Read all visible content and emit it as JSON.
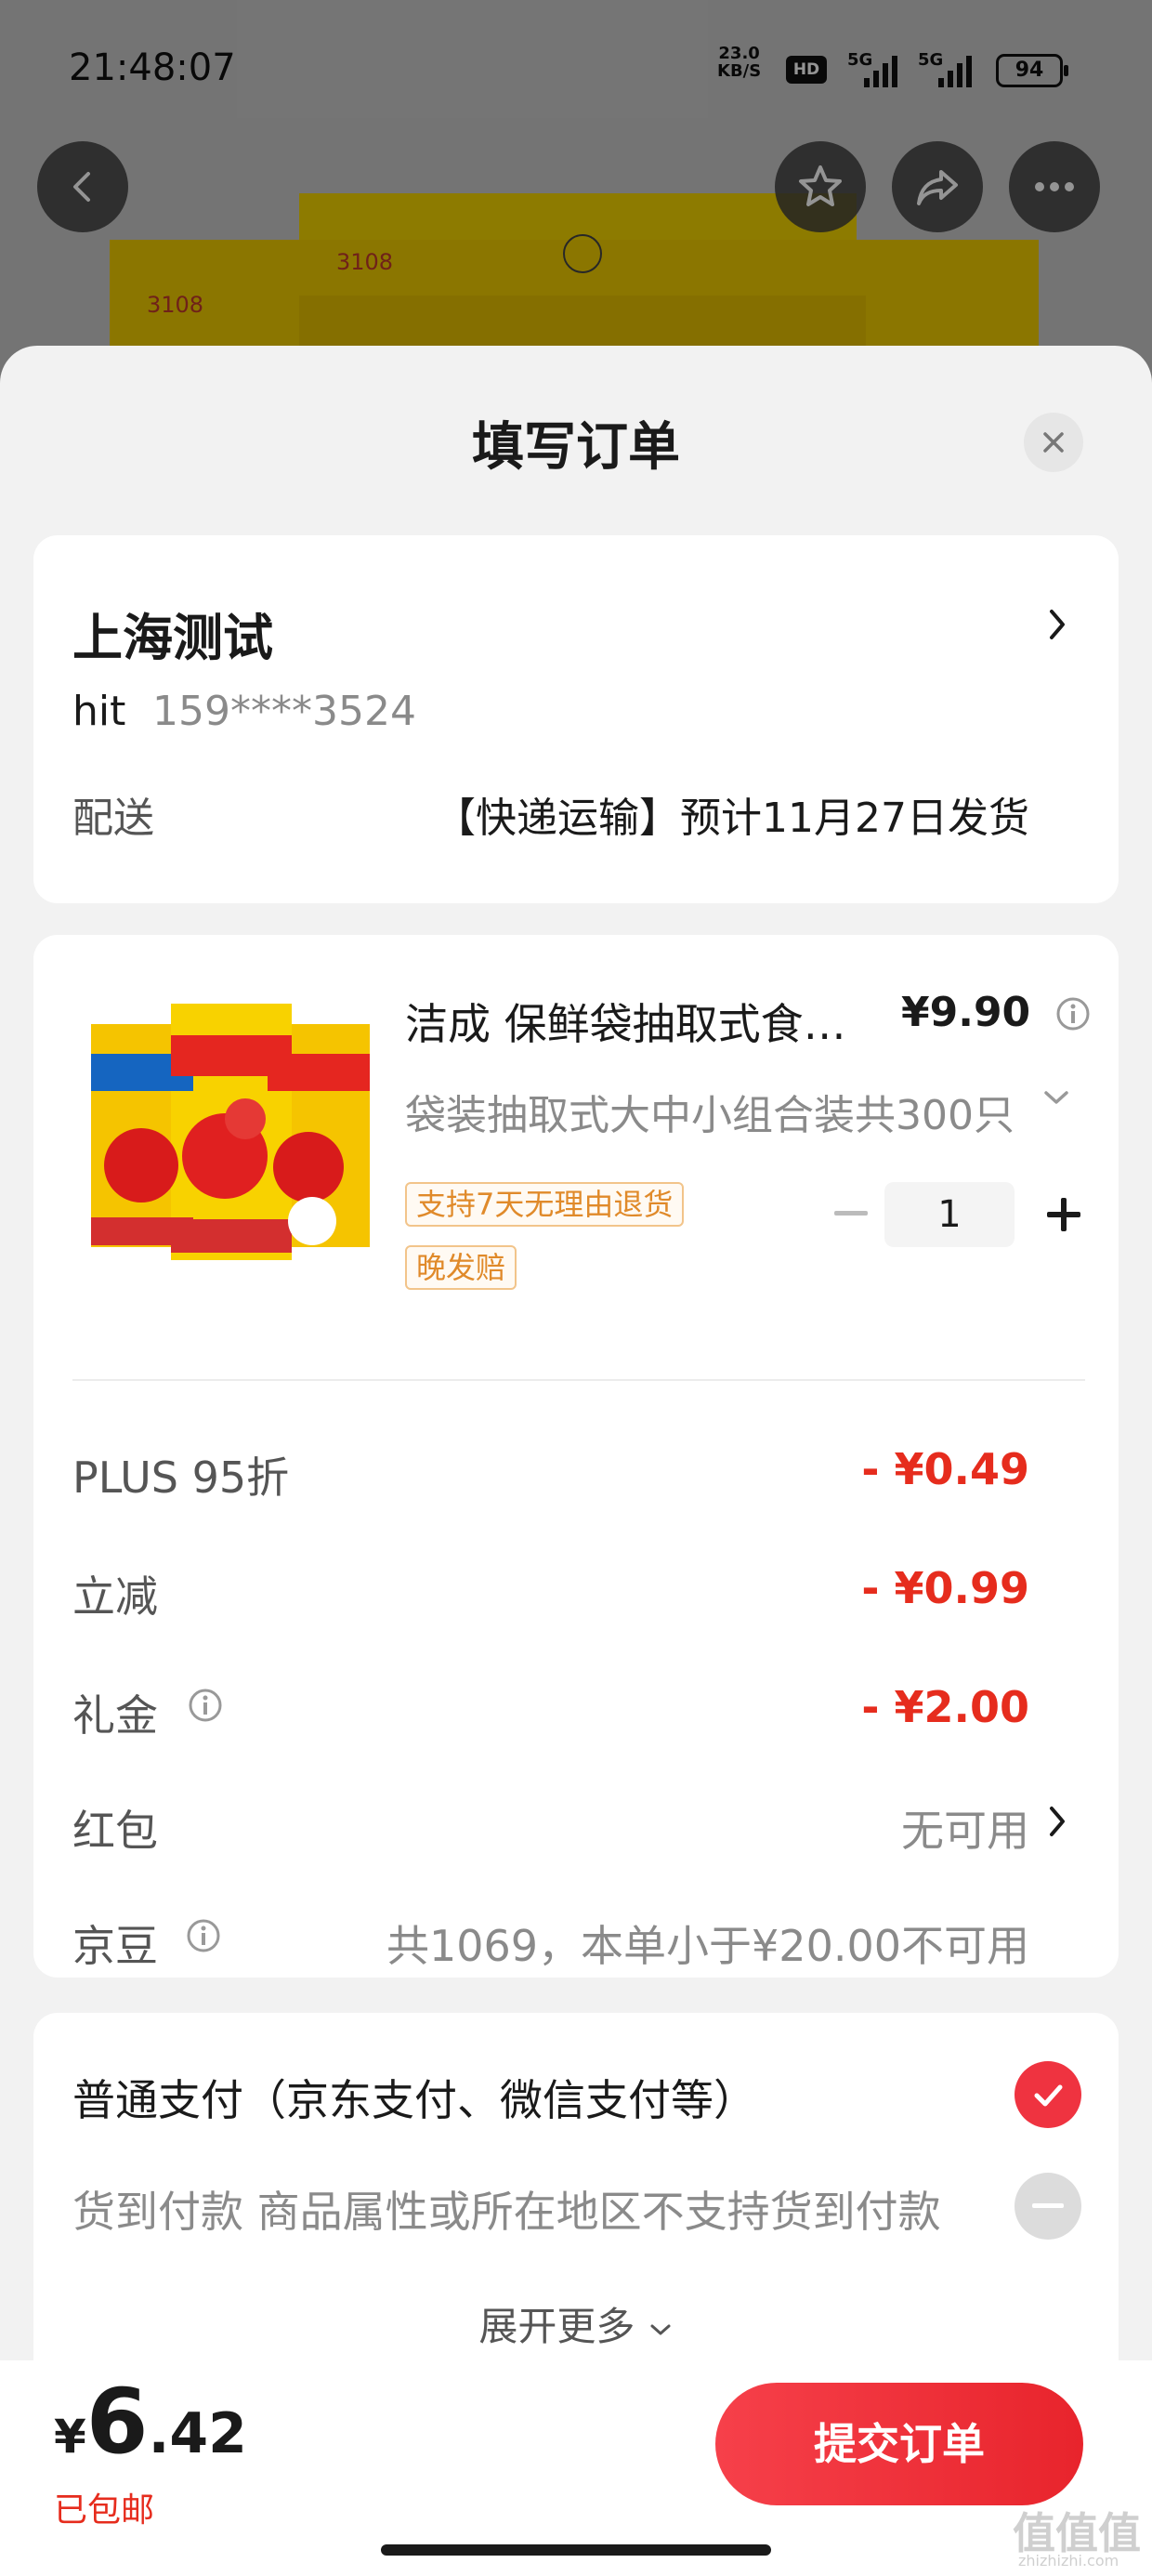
{
  "status_bar": {
    "time": "21:48:07",
    "speed_value": "23.0",
    "speed_unit": "KB/S",
    "hd": "HD",
    "sig1": "5G",
    "sig2": "5G",
    "battery": "94"
  },
  "background": {
    "code1": "3108",
    "code2": "3108"
  },
  "sheet": {
    "title": "填写订单"
  },
  "address": {
    "name": "上海测试",
    "person": "hit",
    "phone": "159****3524",
    "delivery_label": "配送",
    "delivery_value": "【快递运输】预计11月27日发货"
  },
  "product": {
    "name": "洁成 保鲜袋抽取式食品级家用一次性",
    "price": "¥9.90",
    "spec": "袋装抽取式大中小组合装共300只",
    "tags": [
      "支持7天无理由退货",
      "晚发赔"
    ],
    "quantity": "1"
  },
  "discounts": [
    {
      "label": "PLUS 95折",
      "value": "- ¥0.49"
    },
    {
      "label": "立减",
      "value": "- ¥0.99"
    },
    {
      "label": "礼金",
      "value": "- ¥2.00"
    }
  ],
  "redpacket": {
    "label": "红包",
    "value": "无可用"
  },
  "jingdou": {
    "label": "京豆",
    "value": "共1069，本单小于¥20.00不可用"
  },
  "payment": {
    "normal": "普通支付（京东支付、微信支付等）",
    "cod": "货到付款 商品属性或所在地区不支持货到付款",
    "expand": "展开更多"
  },
  "bottom": {
    "yen": "¥",
    "total_int": "6",
    "total_dec": ".42",
    "shipping": "已包邮",
    "submit": "提交订单"
  },
  "watermark": {
    "mark": "值值值",
    "url": "zhizhizhi.com"
  },
  "colors": {
    "accent_red": "#e62c1d",
    "submit_red": "#f03a42",
    "tag_orange": "#e08a2a"
  }
}
